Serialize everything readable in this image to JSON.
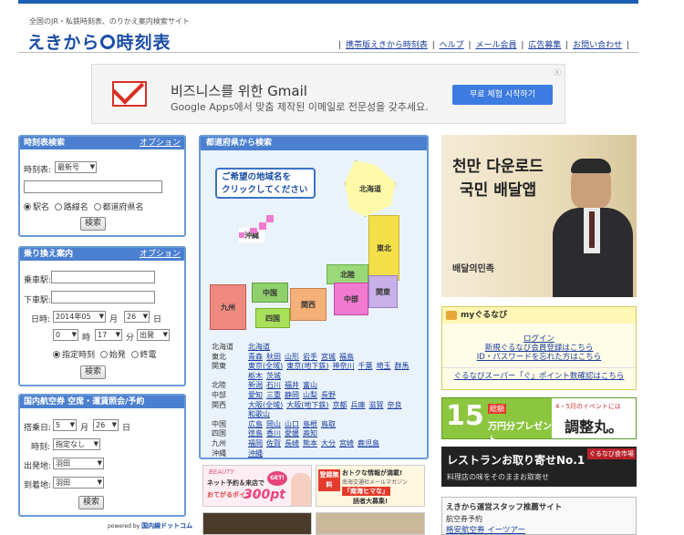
{
  "header": {
    "tagline": "全国のJR・私鉄時刻表、のりかえ案内検索サイト",
    "logo_left": "えきから",
    "logo_right": "時刻表",
    "links": [
      "携帯版えきから時刻表",
      "ヘルプ",
      "メール会員",
      "広告募集",
      "お問い合わせ"
    ]
  },
  "ad_banner": {
    "title": "비즈니스를 위한 Gmail",
    "subtitle": "Google Apps에서 맞춤 제작된 이메일로 전문성을 갖추세요.",
    "button": "무료 체험 시작하기",
    "close": "ⓧ",
    "brand_color": "#d93025",
    "button_color": "#3c7be0"
  },
  "timetable_search": {
    "title": "時刻表検索",
    "option_link": "オプション",
    "edition_label": "時刻表:",
    "edition_value": "最新号",
    "query_value": "",
    "radios": [
      "駅名",
      "路線名",
      "都道府県名"
    ],
    "selected_radio": 0,
    "search_button": "検索"
  },
  "transfer": {
    "title": "乗り換え案内",
    "option_link": "オプション",
    "from_label": "乗車駅:",
    "to_label": "下車駅:",
    "from_value": "",
    "to_value": "",
    "date_label": "日時:",
    "year": "2014年05",
    "month_label": "月",
    "day": "26",
    "day_label": "日",
    "hour": "0",
    "hour_label": "時",
    "minute": "17",
    "minute_label": "分",
    "mode": "出発",
    "radios": [
      "指定時刻",
      "始発",
      "終電"
    ],
    "selected_radio": 0,
    "search_button": "検索"
  },
  "air": {
    "title": "国内航空券 空席・運賃照会/予約",
    "date_label": "搭乗日:",
    "month": "5",
    "month_label": "月",
    "day": "26",
    "day_label": "日",
    "time_label": "時刻:",
    "time_value": "指定なし",
    "from_label": "出発地:",
    "from_value": "羽田",
    "to_label": "到着地:",
    "to_value": "羽田",
    "search_button": "検索",
    "powered_prefix": "powered by",
    "powered_brand": "国内線ドットコム"
  },
  "map": {
    "title": "都道府県から検索",
    "bubble_line1": "ご希望の地域名を",
    "bubble_line2": "クリックしてください",
    "regions": {
      "hokkaido": "北海道",
      "tohoku": "東北",
      "hokuriku": "北陸",
      "kanto": "関東",
      "chubu": "中部",
      "kansai": "関西",
      "chugoku": "中国",
      "shikoku": "四国",
      "kyushu": "九州",
      "okinawa": "沖縄"
    },
    "prefecture_list": [
      {
        "region": "北海道",
        "prefs": [
          "北海道"
        ]
      },
      {
        "region": "東北",
        "prefs": [
          "青森",
          "秋田",
          "山形",
          "岩手",
          "宮城",
          "福島"
        ]
      },
      {
        "region": "関東",
        "prefs": [
          "東京(全域)",
          "東京(地下鉄)",
          "神奈川",
          "千葉",
          "埼玉",
          "群馬"
        ]
      },
      {
        "region": "",
        "prefs": [
          "栃木",
          "茨城"
        ]
      },
      {
        "region": "北陸",
        "prefs": [
          "新潟",
          "石川",
          "福井",
          "富山"
        ]
      },
      {
        "region": "中部",
        "prefs": [
          "愛知",
          "三重",
          "静岡",
          "山梨",
          "長野"
        ]
      },
      {
        "region": "関西",
        "prefs": [
          "大阪(全域)",
          "大阪(地下鉄)",
          "京都",
          "兵庫",
          "滋賀",
          "奈良"
        ]
      },
      {
        "region": "",
        "prefs": [
          "和歌山"
        ]
      },
      {
        "region": "中国",
        "prefs": [
          "広島",
          "岡山",
          "山口",
          "島根",
          "鳥取"
        ]
      },
      {
        "region": "四国",
        "prefs": [
          "徳島",
          "香川",
          "愛媛",
          "高知"
        ]
      },
      {
        "region": "九州",
        "prefs": [
          "福岡",
          "佐賀",
          "長崎",
          "熊本",
          "大分",
          "宮崎",
          "鹿児島"
        ]
      },
      {
        "region": "沖縄",
        "prefs": [
          "沖縄"
        ]
      }
    ]
  },
  "bottom_ads": {
    "beauty_brand": "BEAUTY",
    "beauty_line1": "ネット予約＆来店で",
    "beauty_get": "GET!",
    "beauty_line2": "おてがるポイント",
    "beauty_points": "300pt",
    "mag_badge": "登録無料",
    "mag_line1": "おトクな情報が満載!",
    "mag_line2": "南海交通社メールマガジン",
    "mag_line3": "「南海ヒマな」",
    "mag_line4": "読者大募集!"
  },
  "right": {
    "actor_line1": "천만 다운로드",
    "actor_line2": "국민 배달앱",
    "actor_logo": "배달의민족",
    "gurunavi_title": "myぐるなび",
    "gurunavi_links": [
      "ログイン",
      "新規ぐるなび会員登録はこちら",
      "ID・パスワードを忘れた方はこちら",
      "ぐるなびスーパー「ぐ」ポイント数確認はこちら"
    ],
    "seitai_num": "15",
    "seitai_total": "総額",
    "seitai_unit": "万円分プレゼント",
    "seitai_event": "4・5月のイベントには",
    "seitai_brand": "調整丸。",
    "rest_title": "レストランお取り寄せNo.1",
    "rest_sub": "料理店の味をそのままお取寄せ",
    "rest_brand": "ぐるなび食市場",
    "staff_title": "えきから運営スタッフ推薦サイト",
    "staff_link1": "航空券予約",
    "staff_link2": "格安航空券 イーツアー"
  }
}
